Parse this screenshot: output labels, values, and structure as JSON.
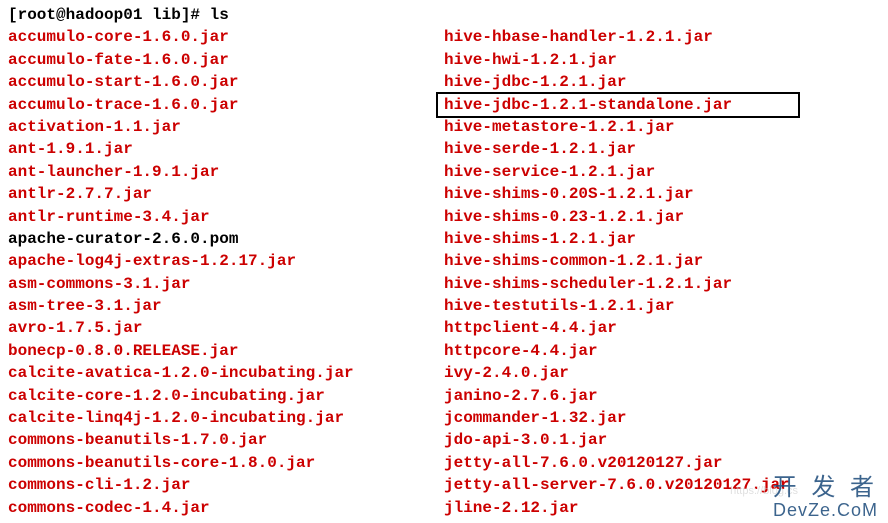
{
  "prompt": "[root@hadoop01 lib]# ls",
  "left_column": [
    {
      "name": "accumulo-core-1.6.0.jar",
      "type": "jar"
    },
    {
      "name": "accumulo-fate-1.6.0.jar",
      "type": "jar"
    },
    {
      "name": "accumulo-start-1.6.0.jar",
      "type": "jar"
    },
    {
      "name": "accumulo-trace-1.6.0.jar",
      "type": "jar"
    },
    {
      "name": "activation-1.1.jar",
      "type": "jar"
    },
    {
      "name": "ant-1.9.1.jar",
      "type": "jar"
    },
    {
      "name": "ant-launcher-1.9.1.jar",
      "type": "jar"
    },
    {
      "name": "antlr-2.7.7.jar",
      "type": "jar"
    },
    {
      "name": "antlr-runtime-3.4.jar",
      "type": "jar"
    },
    {
      "name": "apache-curator-2.6.0.pom",
      "type": "plain"
    },
    {
      "name": "apache-log4j-extras-1.2.17.jar",
      "type": "jar"
    },
    {
      "name": "asm-commons-3.1.jar",
      "type": "jar"
    },
    {
      "name": "asm-tree-3.1.jar",
      "type": "jar"
    },
    {
      "name": "avro-1.7.5.jar",
      "type": "jar"
    },
    {
      "name": "bonecp-0.8.0.RELEASE.jar",
      "type": "jar"
    },
    {
      "name": "calcite-avatica-1.2.0-incubating.jar",
      "type": "jar"
    },
    {
      "name": "calcite-core-1.2.0-incubating.jar",
      "type": "jar"
    },
    {
      "name": "calcite-linq4j-1.2.0-incubating.jar",
      "type": "jar"
    },
    {
      "name": "commons-beanutils-1.7.0.jar",
      "type": "jar"
    },
    {
      "name": "commons-beanutils-core-1.8.0.jar",
      "type": "jar"
    },
    {
      "name": "commons-cli-1.2.jar",
      "type": "jar"
    },
    {
      "name": "commons-codec-1.4.jar",
      "type": "jar"
    }
  ],
  "right_column": [
    {
      "name": "hive-hbase-handler-1.2.1.jar",
      "type": "jar"
    },
    {
      "name": "hive-hwi-1.2.1.jar",
      "type": "jar"
    },
    {
      "name": "hive-jdbc-1.2.1.jar",
      "type": "jar"
    },
    {
      "name": "hive-jdbc-1.2.1-standalone.jar",
      "type": "jar",
      "boxed": true
    },
    {
      "name": "hive-metastore-1.2.1.jar",
      "type": "jar"
    },
    {
      "name": "hive-serde-1.2.1.jar",
      "type": "jar"
    },
    {
      "name": "hive-service-1.2.1.jar",
      "type": "jar"
    },
    {
      "name": "hive-shims-0.20S-1.2.1.jar",
      "type": "jar"
    },
    {
      "name": "hive-shims-0.23-1.2.1.jar",
      "type": "jar"
    },
    {
      "name": "hive-shims-1.2.1.jar",
      "type": "jar"
    },
    {
      "name": "hive-shims-common-1.2.1.jar",
      "type": "jar"
    },
    {
      "name": "hive-shims-scheduler-1.2.1.jar",
      "type": "jar"
    },
    {
      "name": "hive-testutils-1.2.1.jar",
      "type": "jar"
    },
    {
      "name": "httpclient-4.4.jar",
      "type": "jar"
    },
    {
      "name": "httpcore-4.4.jar",
      "type": "jar"
    },
    {
      "name": "ivy-2.4.0.jar",
      "type": "jar"
    },
    {
      "name": "janino-2.7.6.jar",
      "type": "jar"
    },
    {
      "name": "jcommander-1.32.jar",
      "type": "jar"
    },
    {
      "name": "jdo-api-3.0.1.jar",
      "type": "jar"
    },
    {
      "name": "jetty-all-7.6.0.v20120127.jar",
      "type": "jar"
    },
    {
      "name": "jetty-all-server-7.6.0.v20120127.jar",
      "type": "jar"
    },
    {
      "name": "jline-2.12.jar",
      "type": "jar"
    }
  ],
  "watermark": {
    "top": "开 发 者",
    "bottom": "DevZe.CoM",
    "blog": "https://blog.cs"
  }
}
